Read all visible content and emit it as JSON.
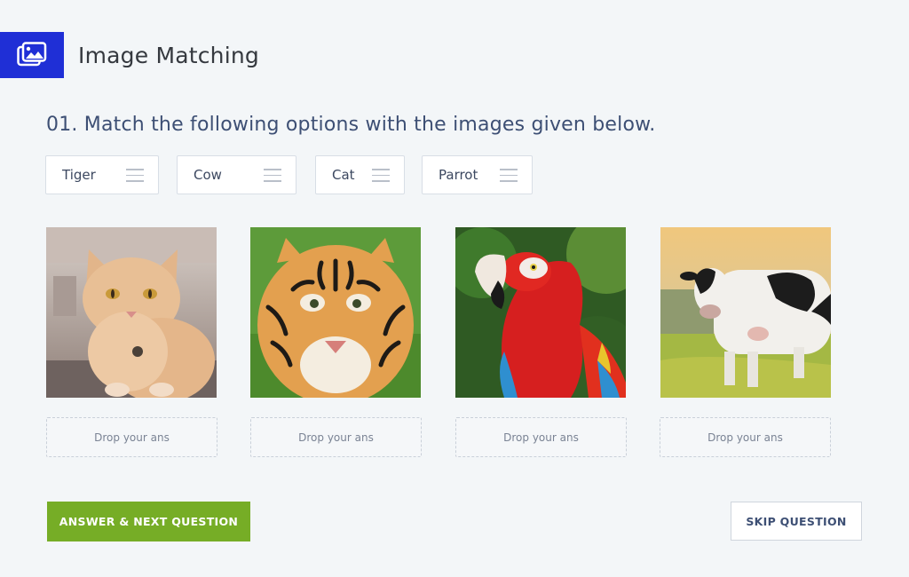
{
  "header": {
    "title": "Image Matching",
    "icon": "images-icon"
  },
  "question": {
    "text": "01. Match the following options with the images given below."
  },
  "options": [
    {
      "label": "Tiger"
    },
    {
      "label": "Cow"
    },
    {
      "label": "Cat"
    },
    {
      "label": "Parrot"
    }
  ],
  "images": [
    {
      "subject": "cat"
    },
    {
      "subject": "tiger"
    },
    {
      "subject": "parrot"
    },
    {
      "subject": "cow"
    }
  ],
  "dropzones": [
    {
      "placeholder": "Drop your ans"
    },
    {
      "placeholder": "Drop your ans"
    },
    {
      "placeholder": "Drop your ans"
    },
    {
      "placeholder": "Drop your ans"
    }
  ],
  "actions": {
    "submit_label": "ANSWER & NEXT QUESTION",
    "skip_label": "SKIP QUESTION"
  },
  "colors": {
    "brand": "#1f2fd6",
    "primary_button": "#76ad26",
    "background": "#f3f6f8"
  }
}
